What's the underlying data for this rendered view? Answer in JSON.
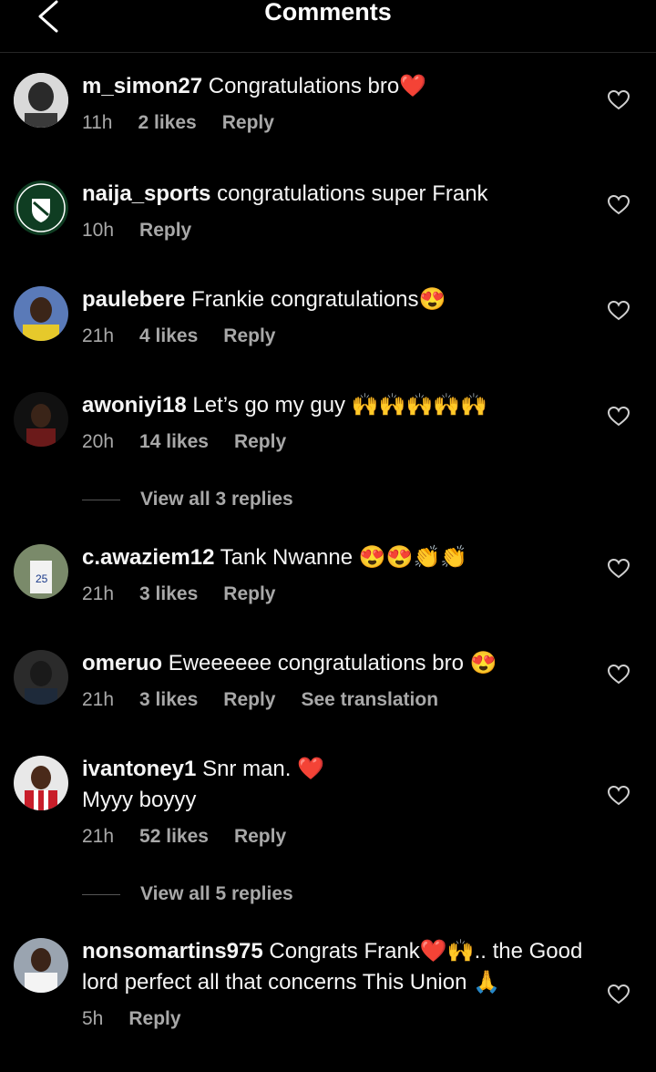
{
  "header": {
    "title": "Comments"
  },
  "comments": [
    {
      "user": "m_simon27",
      "text": "Congratulations bro❤️",
      "time": "11h",
      "likes": "2 likes",
      "reply": "Reply"
    },
    {
      "user": "naija_sports",
      "text": "congratulations super Frank",
      "time": "10h",
      "reply": "Reply"
    },
    {
      "user": "paulebere",
      "text": "Frankie congratulations😍",
      "time": "21h",
      "likes": "4 likes",
      "reply": "Reply"
    },
    {
      "user": "awoniyi18",
      "text": "Let’s go my guy 🙌🙌🙌🙌🙌",
      "time": "20h",
      "likes": "14 likes",
      "reply": "Reply"
    },
    {
      "user": "c.awaziem12",
      "text": "Tank Nwanne 😍😍👏👏",
      "time": "21h",
      "likes": "3 likes",
      "reply": "Reply"
    },
    {
      "user": "omeruo",
      "text": "Eweeeeee congratulations bro 😍",
      "time": "21h",
      "likes": "3 likes",
      "reply": "Reply",
      "translate": "See translation"
    },
    {
      "user": "ivantoney1",
      "text": "Snr man. ❤️",
      "text2": "Myyy boyyy",
      "time": "21h",
      "likes": "52 likes",
      "reply": "Reply"
    },
    {
      "user": "nonsomartins975",
      "text": "Congrats Frank❤️🙌.. the Good lord perfect all that concerns This Union 🙏",
      "time": "5h",
      "reply": "Reply"
    }
  ],
  "view_replies": [
    {
      "label": "View all 3 replies"
    },
    {
      "label": "View all 5 replies"
    }
  ],
  "colors": {
    "background": "#000000",
    "secondary_text": "#a8a8a8",
    "primary_text": "#f5f5f5"
  }
}
